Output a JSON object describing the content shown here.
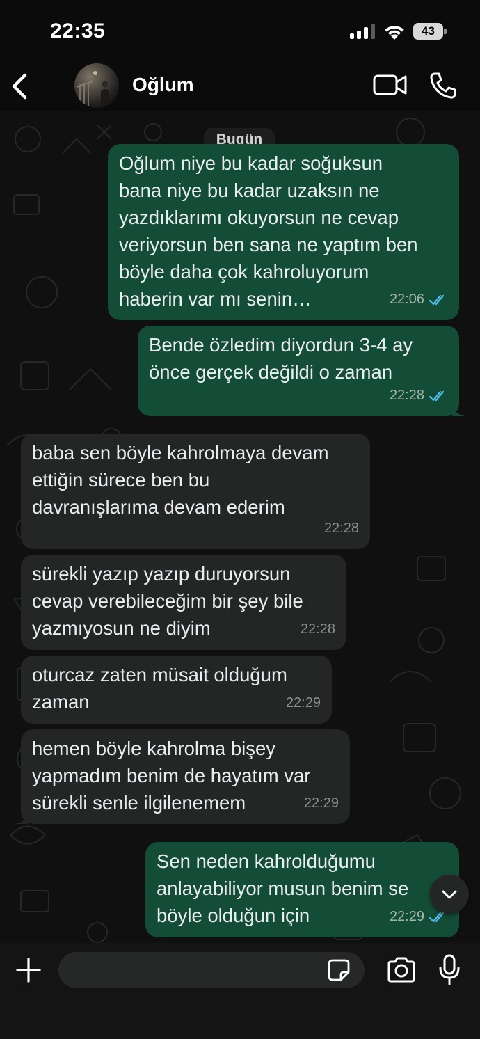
{
  "status_bar": {
    "time": "22:35",
    "battery": "43"
  },
  "header": {
    "contact_name": "Oğlum",
    "icons": [
      "back-icon",
      "avatar",
      "video-call-icon",
      "phone-call-icon"
    ]
  },
  "chat": {
    "date_label": "Bugün",
    "messages": [
      {
        "direction": "outgoing",
        "text": "Oğlum niye bu kadar soğuksun\nbana niye bu kadar uzaksın ne\nyazdıklarımı okuyorsun ne cevap\nveriyorsun ben sana ne yaptım ben\nböyle daha çok kahroluyorum\nhaberin var mı senin…",
        "time": "22:06",
        "status": "read"
      },
      {
        "direction": "outgoing",
        "text": "Bende özledim diyordun 3-4 ay\nönce gerçek değildi o zaman",
        "time": "22:28",
        "status": "read"
      },
      {
        "direction": "incoming",
        "text": "baba sen böyle kahrolmaya devam\nettiğin sürece ben bu\ndavranışlarıma devam ederim",
        "time": "22:28"
      },
      {
        "direction": "incoming",
        "text": "sürekli yazıp yazıp duruyorsun\ncevap verebileceğim bir şey bile\nyazmıyosun ne diyim",
        "time": "22:28"
      },
      {
        "direction": "incoming",
        "text": "oturcaz zaten müsait olduğum\nzaman",
        "time": "22:29"
      },
      {
        "direction": "incoming",
        "text": "hemen böyle kahrolma bişey\nyapmadım benim de hayatım var\nsürekli senle ilgilenemem",
        "time": "22:29"
      },
      {
        "direction": "outgoing",
        "text": "Sen neden kahrolduğumu\nanlayabiliyor musun benim se\nböyle olduğun için",
        "time": "22:29",
        "status": "read"
      }
    ]
  },
  "input_bar": {
    "placeholder": "",
    "icons": [
      "plus-icon",
      "sticker-icon",
      "camera-icon",
      "microphone-icon"
    ]
  },
  "colors": {
    "outgoing_bubble": "#144d37",
    "incoming_bubble": "#242626",
    "read_ticks": "#53bdeb",
    "background": "#0b0b0b"
  }
}
